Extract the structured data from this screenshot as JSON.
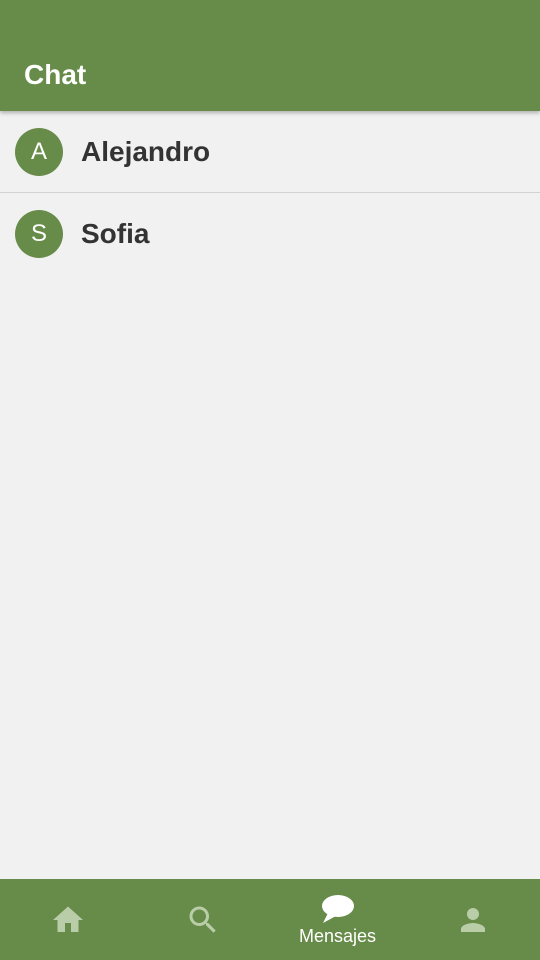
{
  "header": {
    "title": "Chat"
  },
  "colors": {
    "primary": "#678b48",
    "background": "#f1f1f1",
    "nav_inactive_icon": "#b9cda8",
    "text_dark": "#333333"
  },
  "chats": [
    {
      "initial": "A",
      "name": "Alejandro"
    },
    {
      "initial": "S",
      "name": "Sofia"
    }
  ],
  "bottom_nav": {
    "items": [
      {
        "icon": "home-icon",
        "label": "",
        "active": false
      },
      {
        "icon": "search-icon",
        "label": "",
        "active": false
      },
      {
        "icon": "chat-bubble-icon",
        "label": "Mensajes",
        "active": true
      },
      {
        "icon": "person-icon",
        "label": "",
        "active": false
      }
    ]
  }
}
